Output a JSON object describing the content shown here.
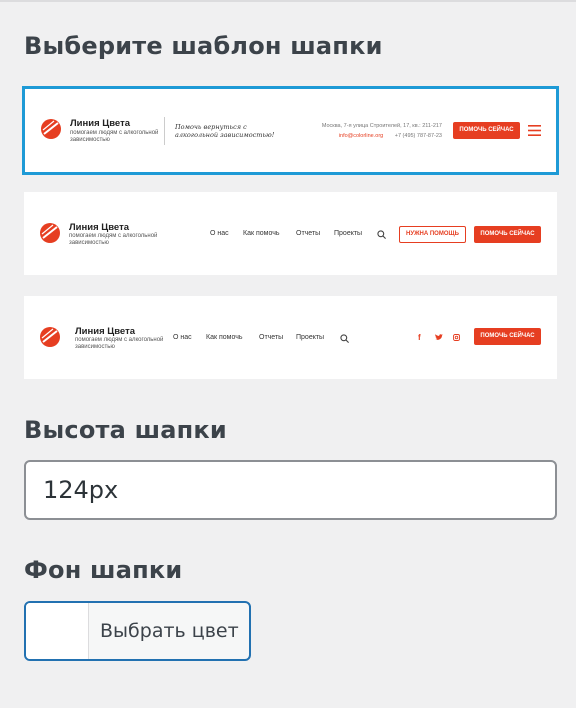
{
  "header_template": {
    "title": "Выберите шаблон шапки",
    "templates": [
      {
        "brand_name": "Линия Цвета",
        "brand_tagline": "помогаем людям с алкогольной зависимостью",
        "slogan": "Помочь вернуться с алкогольной зависимостью!",
        "address": "Москва, 7-я улица Строителей, 17, кв.: 211-217",
        "email": "info@colorline.org",
        "phone": "+7 (495) 787-87-23",
        "cta": "ПОМОЧЬ СЕЙЧАС",
        "menu_icon": "hamburger-icon",
        "selected": true
      },
      {
        "brand_name": "Линия Цвета",
        "brand_tagline": "помогаем людям с алкогольной зависимостью",
        "nav": [
          "О нас",
          "Как помочь",
          "Отчеты",
          "Проекты"
        ],
        "search_icon": "search-icon",
        "secondary_cta": "НУЖНА ПОМОЩЬ",
        "cta": "ПОМОЧЬ СЕЙЧАС"
      },
      {
        "brand_name": "Линия Цвета",
        "brand_tagline": "помогаем людям с алкогольной зависимостью",
        "nav": [
          "О нас",
          "Как помочь",
          "Отчеты",
          "Проекты"
        ],
        "search_icon": "search-icon",
        "social": [
          "f",
          "twitter-icon",
          "instagram-icon"
        ],
        "cta": "ПОМОЧЬ СЕЙЧАС"
      }
    ]
  },
  "header_height": {
    "label": "Высота шапки",
    "value": "124px"
  },
  "header_background": {
    "label": "Фон шапки",
    "button_label": "Выбрать цвет",
    "current_color": "#ffffff"
  },
  "colors": {
    "accent": "#e63e21",
    "selection": "#1e9ad6",
    "focus": "#2271b1"
  }
}
